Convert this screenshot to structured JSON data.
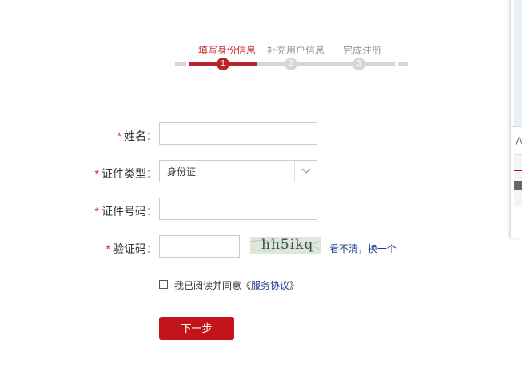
{
  "steps": [
    {
      "label": "填写身份信息",
      "number": "1",
      "active": true
    },
    {
      "label": "补充用户信息",
      "number": "2",
      "active": false
    },
    {
      "label": "完成注册",
      "number": "3",
      "active": false
    }
  ],
  "form": {
    "required_mark": "*",
    "name_label": "姓名：",
    "name_value": "",
    "id_type_label": "证件类型：",
    "id_type_value": "身份证",
    "id_number_label": "证件号码：",
    "id_number_value": "",
    "captcha_label": "验证码：",
    "captcha_value": "",
    "captcha_image_text": "hh5ikq",
    "captcha_refresh": "看不清，换一个",
    "agree_text": "我已阅读并同意《",
    "agree_link": "服务协议",
    "agree_end": "》",
    "agree_checked": false,
    "next_button": "下一步"
  },
  "side_panel": {
    "letter": "A"
  },
  "colors": {
    "accent": "#c3141b",
    "active_step": "#b9252a",
    "link": "#1a3e8c",
    "inactive": "#d6d6d6"
  }
}
